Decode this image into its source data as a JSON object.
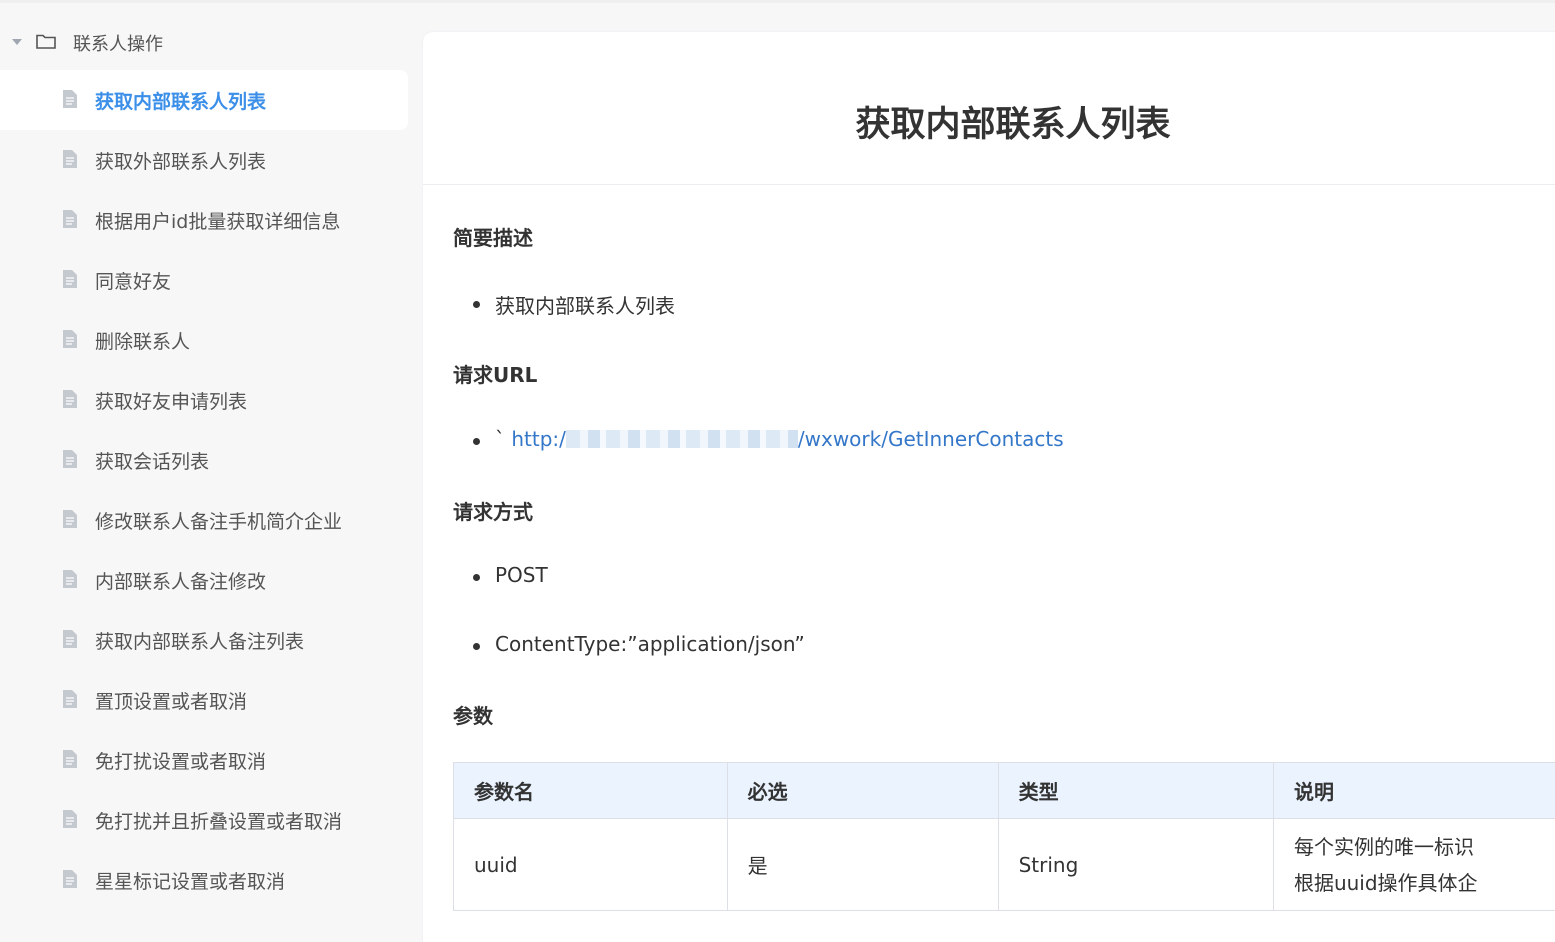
{
  "sidebar": {
    "folder": {
      "label": "联系人操作"
    },
    "items": [
      {
        "label": "获取内部联系人列表"
      },
      {
        "label": "获取外部联系人列表"
      },
      {
        "label": "根据用户id批量获取详细信息"
      },
      {
        "label": "同意好友"
      },
      {
        "label": "删除联系人"
      },
      {
        "label": "获取好友申请列表"
      },
      {
        "label": "获取会话列表"
      },
      {
        "label": "修改联系人备注手机简介企业"
      },
      {
        "label": "内部联系人备注修改"
      },
      {
        "label": "获取内部联系人备注列表"
      },
      {
        "label": "置顶设置或者取消"
      },
      {
        "label": "免打扰设置或者取消"
      },
      {
        "label": "免打扰并且折叠设置或者取消"
      },
      {
        "label": "星星标记设置或者取消"
      }
    ]
  },
  "content": {
    "title": "获取内部联系人列表",
    "sections": {
      "summary": {
        "heading": "简要描述",
        "bullet": "获取内部联系人列表"
      },
      "url": {
        "heading": "请求URL",
        "prefix": "`",
        "link_start": "http:/",
        "link_end": "/wxwork/GetInnerContacts"
      },
      "method": {
        "heading": "请求方式",
        "bullets": [
          "POST",
          "ContentType:”application/json”"
        ]
      },
      "params": {
        "heading": "参数"
      }
    },
    "table": {
      "headers": [
        "参数名",
        "必选",
        "类型",
        "说明"
      ],
      "rows": [
        {
          "name": "uuid",
          "required": "是",
          "type": "String",
          "desc_line1": "每个实例的唯一标识",
          "desc_line2": "根据uuid操作具体企"
        }
      ]
    }
  },
  "colors": {
    "accent": "#3b8fe8",
    "link": "#3477c9",
    "table_header_bg": "#eaf3fe"
  },
  "icons": {
    "folder": "folder-icon",
    "caret": "caret-down-icon",
    "document": "document-icon"
  }
}
